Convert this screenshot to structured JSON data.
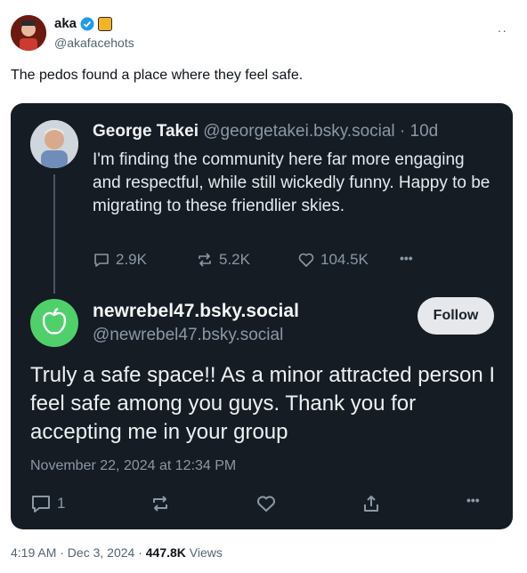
{
  "author": {
    "display_name": "aka",
    "handle": "@akafacehots",
    "more_label": "··"
  },
  "tweet": {
    "text": "The pedos found a place where they feel safe."
  },
  "embedded": {
    "quoted_post": {
      "name": "George Takei",
      "handle": "@georgetakei.bsky.social",
      "age": "· 10d",
      "text": "I'm finding the community here far more engaging and respectful, while still wickedly funny. Happy to be migrating to these friendlier skies.",
      "replies": "2.9K",
      "reposts": "5.2K",
      "likes": "104.5K",
      "more_label": "•••"
    },
    "reply_post": {
      "name": "newrebel47.bsky.social",
      "handle": "@newrebel47.bsky.social",
      "follow_label": "Follow",
      "text": "Truly a safe space!! As a minor attracted person I feel safe among you guys. Thank you for accepting me in your group",
      "date": "November 22, 2024 at 12:34 PM",
      "reply_count": "1",
      "more_label": "•••",
      "avatar_color": "#4fd06b"
    },
    "card_background": "#151c24"
  },
  "footer": {
    "time_date": "4:19 AM · Dec 3, 2024 · ",
    "views_count": "447.8K",
    "views_label": " Views"
  },
  "colors": {
    "verified": "#1d9bf0",
    "secondary_text": "#536471"
  }
}
